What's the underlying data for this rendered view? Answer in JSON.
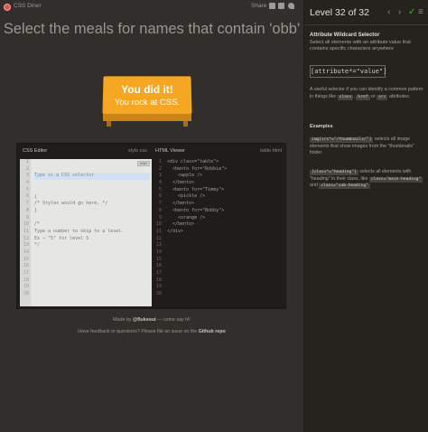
{
  "app": {
    "title": "CSS Diner",
    "share_label": "Share"
  },
  "share_icons": [
    "mail-icon",
    "facebook-icon",
    "twitter-icon"
  ],
  "instruction": "Select the meals for names that contain 'obb'",
  "win": {
    "line1": "You did it!",
    "line2": "You rock at CSS."
  },
  "css_editor": {
    "title": "CSS Editor",
    "filename": "style.css",
    "placeholder": "Type in a CSS selector",
    "enter_label": "enter",
    "line_numbers": [
      "1",
      "2",
      "3",
      "4",
      "5",
      "6",
      "7",
      "8",
      "9",
      "10",
      "11",
      "12",
      "13",
      "14",
      "15",
      "16",
      "17",
      "18",
      "19",
      "20"
    ],
    "lines": [
      "{",
      "/* Styles would go here. */",
      "}",
      "",
      "/*",
      "Type a number to skip to a level.",
      "Ex → \"5\" for level 5",
      "*/"
    ]
  },
  "html_viewer": {
    "title": "HTML Viewer",
    "filename": "table.html",
    "line_numbers": [
      "1",
      "2",
      "3",
      "4",
      "5",
      "6",
      "7",
      "8",
      "9",
      "10",
      "11",
      "12",
      "13",
      "14",
      "15",
      "16",
      "17",
      "18",
      "19",
      "20"
    ],
    "lines": [
      "<div class=\"table\">",
      "  <bento for=\"Robbie\">",
      "    <apple />",
      "  </bento>",
      "  <bento for=\"Timmy\">",
      "    <pickle />",
      "  </bento>",
      "  <bento for=\"Bobby\">",
      "    <orange />",
      "  </bento>",
      "</div>"
    ]
  },
  "footer": {
    "made_by_prefix": "Made by ",
    "author": "@flukeout",
    "made_by_suffix": " — come say hi!",
    "feedback_prefix": "Have feedback or questions? Please file an issue on the ",
    "repo_link": "Github repo"
  },
  "sidebar": {
    "level_title": "Level 32 of 32",
    "nav_icons": [
      "chevron-left-icon",
      "chevron-right-icon",
      "checkmark-icon",
      "menu-icon"
    ],
    "selector_name": "Attribute Wildcard Selector",
    "description": "Select all elements with an attribute value that contains specific characters anywhere",
    "syntax": "[attribute*=\"value\"]",
    "hint_before": "A useful selector if you can identify a common pattern in things like ",
    "hint_tags": [
      "class",
      "href",
      "src"
    ],
    "hint_after": " attributes.",
    "examples_title": "Examples",
    "example1_code": "img[src*=\"/thumbnails/\"]",
    "example1_text": " selects all image elements that show images from the \"thumbnails\" folder.",
    "example2_code": "[class*=\"heading\"]",
    "example2_text_a": " selects all elements with \"heading\" in their class, like ",
    "example2_tag1": "class=\"main-heading\"",
    "example2_text_b": " and ",
    "example2_tag2": "class=\"sub-heading\""
  },
  "colors": {
    "background": "#312e2b",
    "sidebar": "#26231f",
    "plate": "#f5a623",
    "accent_red": "#e2554b",
    "check_green": "#4cae4c"
  }
}
